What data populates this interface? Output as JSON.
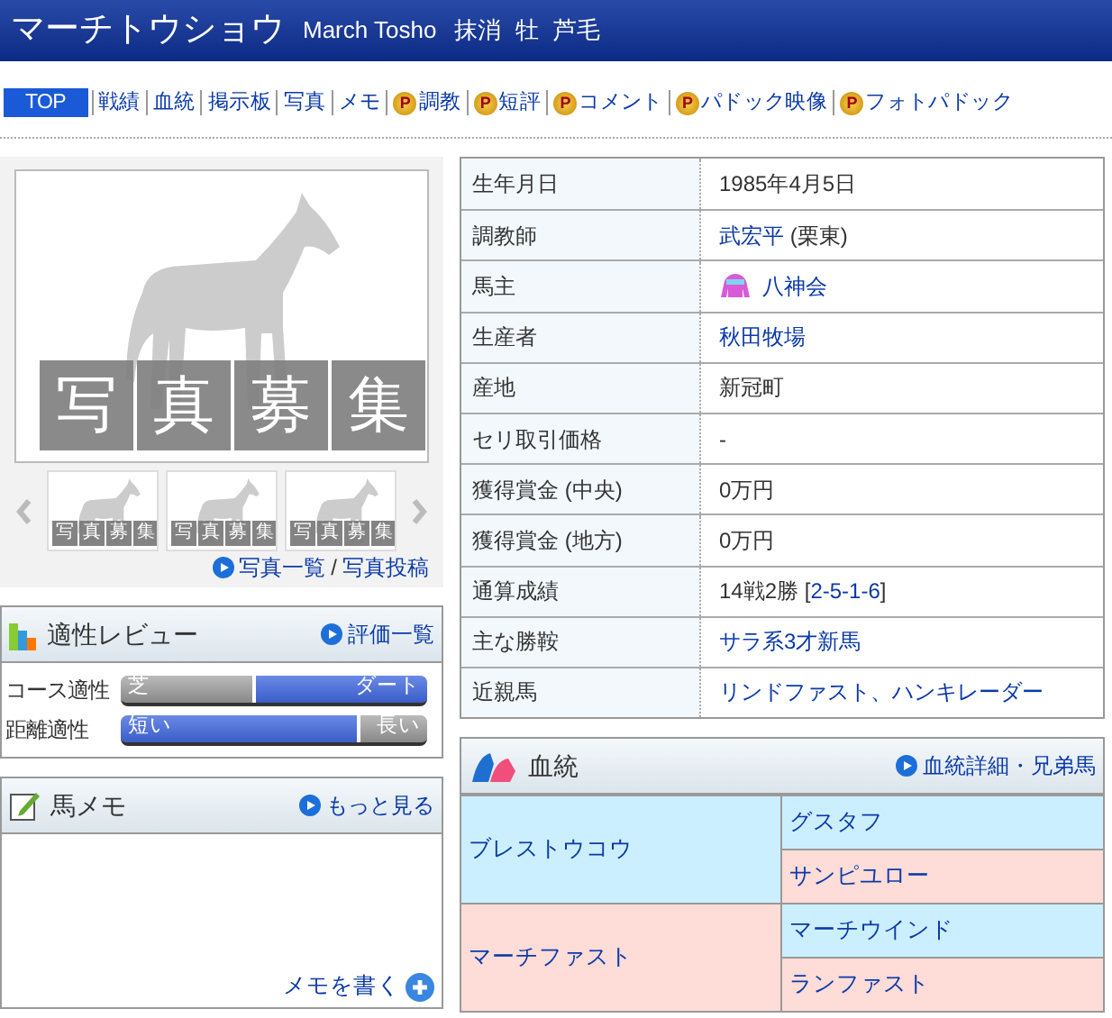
{
  "header": {
    "name": "マーチトウショウ",
    "name_en": "March Tosho",
    "status": "抹消",
    "sex": "牡",
    "coat": "芦毛"
  },
  "nav": [
    {
      "label": "TOP",
      "selected": true
    },
    {
      "label": "戦績",
      "selected": false
    },
    {
      "label": "血統",
      "selected": false
    },
    {
      "label": "掲示板",
      "selected": false
    },
    {
      "label": "写真",
      "selected": false
    },
    {
      "label": "メモ",
      "selected": false
    },
    {
      "label": "調教",
      "selected": false,
      "badge": "P"
    },
    {
      "label": "短評",
      "selected": false,
      "badge": "P"
    },
    {
      "label": "コメント",
      "selected": false,
      "badge": "P"
    },
    {
      "label": "パドック映像",
      "selected": false,
      "badge": "P"
    },
    {
      "label": "フォトパドック",
      "selected": false,
      "badge": "P"
    }
  ],
  "photo": {
    "caption": [
      "写",
      "真",
      "募",
      "集"
    ],
    "thumbnails": [
      [
        "写",
        "真",
        "募",
        "集"
      ],
      [
        "写",
        "真",
        "募",
        "集"
      ],
      [
        "写",
        "真",
        "募",
        "集"
      ]
    ],
    "links": [
      "写真一覧",
      "写真投稿"
    ],
    "separator": "/"
  },
  "aptitude": {
    "title": "適性レビュー",
    "link": "評価一覧",
    "rows": [
      {
        "label": "コース適性",
        "left": "芝",
        "right": "ダート",
        "level": 0.57,
        "fill_from_right": true
      },
      {
        "label": "距離適性",
        "left": "短い",
        "right": "長い",
        "level": 0.77,
        "fill_from_right": false
      }
    ]
  },
  "memo": {
    "title": "馬メモ",
    "link": "もっと見る",
    "write": "メモを書く"
  },
  "profile": [
    {
      "label": "生年月日",
      "value": [
        {
          "text": "1985年4月5日",
          "link": false
        }
      ]
    },
    {
      "label": "調教師",
      "value": [
        {
          "text": "武宏平",
          "link": true
        },
        {
          "text": " (栗東)",
          "link": false
        }
      ]
    },
    {
      "label": "馬主",
      "silks": true,
      "value": [
        {
          "text": "八神会",
          "link": true
        }
      ]
    },
    {
      "label": "生産者",
      "value": [
        {
          "text": "秋田牧場",
          "link": true
        }
      ]
    },
    {
      "label": "産地",
      "value": [
        {
          "text": "新冠町",
          "link": false
        }
      ]
    },
    {
      "label": "セリ取引価格",
      "value": [
        {
          "text": "-",
          "link": false
        }
      ]
    },
    {
      "label": "獲得賞金 (中央)",
      "value": [
        {
          "text": "0万円",
          "link": false
        }
      ]
    },
    {
      "label": "獲得賞金 (地方)",
      "value": [
        {
          "text": "0万円",
          "link": false
        }
      ]
    },
    {
      "label": "通算成績",
      "value": [
        {
          "text": "14戦2勝 [",
          "link": false
        },
        {
          "text": "2-5-1-6",
          "link": true
        },
        {
          "text": "]",
          "link": false
        }
      ]
    },
    {
      "label": "主な勝鞍",
      "value": [
        {
          "text": "サラ系3才新馬",
          "link": true
        }
      ]
    },
    {
      "label": "近親馬",
      "value": [
        {
          "text": "リンドファスト、ハンキレーダー",
          "link": true
        }
      ]
    }
  ],
  "pedigree": {
    "title": "血統",
    "link": "血統詳細・兄弟馬",
    "parents": [
      {
        "name": "ブレストウコウ",
        "color": "#ccefff",
        "parents": [
          {
            "name": "グスタフ",
            "color": "#ccefff"
          },
          {
            "name": "サンピユロー",
            "color": "#fedcd7"
          }
        ]
      },
      {
        "name": "マーチファスト",
        "color": "#fedcd7",
        "parents": [
          {
            "name": "マーチウインド",
            "color": "#ccefff"
          },
          {
            "name": "ランファスト",
            "color": "#fedcd7"
          }
        ]
      }
    ]
  }
}
